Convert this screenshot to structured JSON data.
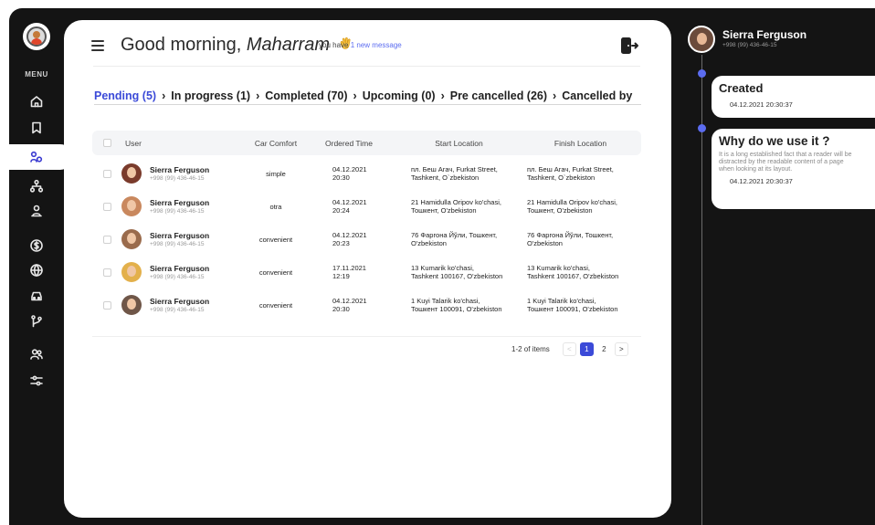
{
  "sidebar": {
    "menu_label": "MENU",
    "items": [
      {
        "icon": "home-icon",
        "active": false
      },
      {
        "icon": "bookmark-icon",
        "active": false
      },
      {
        "icon": "users-link-icon",
        "active": true
      },
      {
        "icon": "network-icon",
        "active": false
      },
      {
        "icon": "driver-icon",
        "active": false
      },
      {
        "icon": "dollar-icon",
        "active": false
      },
      {
        "icon": "globe-icon",
        "active": false
      },
      {
        "icon": "car-icon",
        "active": false
      },
      {
        "icon": "route-icon",
        "active": false
      },
      {
        "icon": "group-icon",
        "active": false
      },
      {
        "icon": "settings-sliders-icon",
        "active": false
      }
    ]
  },
  "header": {
    "greeting_prefix": "Good morning, ",
    "greeting_name": "Maharram",
    "wave_icon": "waving-hand-icon",
    "message_prefix": "you have ",
    "message_link": "1 new message",
    "exit_icon": "logout-icon"
  },
  "tabs": [
    {
      "label": "Pending (5)",
      "active": true
    },
    {
      "label": "In progress (1)",
      "active": false
    },
    {
      "label": "Completed (70)",
      "active": false
    },
    {
      "label": "Upcoming (0)",
      "active": false
    },
    {
      "label": "Pre cancelled (26)",
      "active": false
    },
    {
      "label": "Cancelled by",
      "active": false
    }
  ],
  "table": {
    "columns": {
      "user": "User",
      "comfort": "Car Comfort",
      "time": "Ordered Time",
      "start": "Start Location",
      "finish": "Finish Location"
    },
    "rows": [
      {
        "name": "Sierra Ferguson",
        "phone": "+998 (99) 436-46-15",
        "comfort": "simple",
        "date": "04.12.2021",
        "time": "20:30",
        "start_1": "пл. Беш Агач, Furkat Street,",
        "start_2": "Tashkent, O`zbekiston",
        "finish_1": "пл. Беш Агач, Furkat Street,",
        "finish_2": "Tashkent, O`zbekiston"
      },
      {
        "name": "Sierra Ferguson",
        "phone": "+998 (99) 436-46-15",
        "comfort": "otra",
        "date": "04.12.2021",
        "time": "20:24",
        "start_1": "21 Hamidulla Oripov ko'chasi,",
        "start_2": "Тошкент, O'zbekiston",
        "finish_1": "21 Hamidulla Oripov ko'chasi,",
        "finish_2": "Тошкент, O'zbekiston"
      },
      {
        "name": "Sierra Ferguson",
        "phone": "+998 (99) 436-46-15",
        "comfort": "convenient",
        "date": "04.12.2021",
        "time": "20:23",
        "start_1": "76 Фаргона Йўли, Тошкент,",
        "start_2": "O'zbekiston",
        "finish_1": "76 Фаргона Йўли, Тошкент,",
        "finish_2": "O'zbekiston"
      },
      {
        "name": "Sierra Ferguson",
        "phone": "+998 (99) 436-46-15",
        "comfort": "convenient",
        "date": "17.11.2021",
        "time": "12:19",
        "start_1": "13 Kumarik ko'chasi,",
        "start_2": "Tashkent 100167, O'zbekiston",
        "finish_1": "13 Kumarik ko'chasi,",
        "finish_2": "Tashkent 100167, O'zbekiston"
      },
      {
        "name": "Sierra Ferguson",
        "phone": "+998 (99) 436-46-15",
        "comfort": "convenient",
        "date": "04.12.2021",
        "time": "20:30",
        "start_1": "1 Kuyi Talarik ko'chasi,",
        "start_2": "Тошкент 100091, O'zbekiston",
        "finish_1": "1 Kuyi Talarik ko'chasi,",
        "finish_2": "Тошкент 100091, O'zbekiston"
      }
    ]
  },
  "pagination": {
    "label": "1-2 of items",
    "prev": "<",
    "pages": [
      "1",
      "2"
    ],
    "current": "1",
    "next": ">"
  },
  "profile": {
    "name": "Sierra Ferguson",
    "phone": "+998 (99) 436-46-15"
  },
  "timeline": [
    {
      "title": "Created",
      "date": "04.12.2021 20:30:37"
    },
    {
      "title": "Why do we use it ?",
      "description": "It is a long established fact that a reader will be distracted by the readable content of a page when looking at its layout.",
      "date": "04.12.2021 20:30:37"
    }
  ],
  "colors": {
    "accent": "#3b4ad8",
    "dark": "#141414",
    "timeline_dot": "#5b6cf0"
  }
}
